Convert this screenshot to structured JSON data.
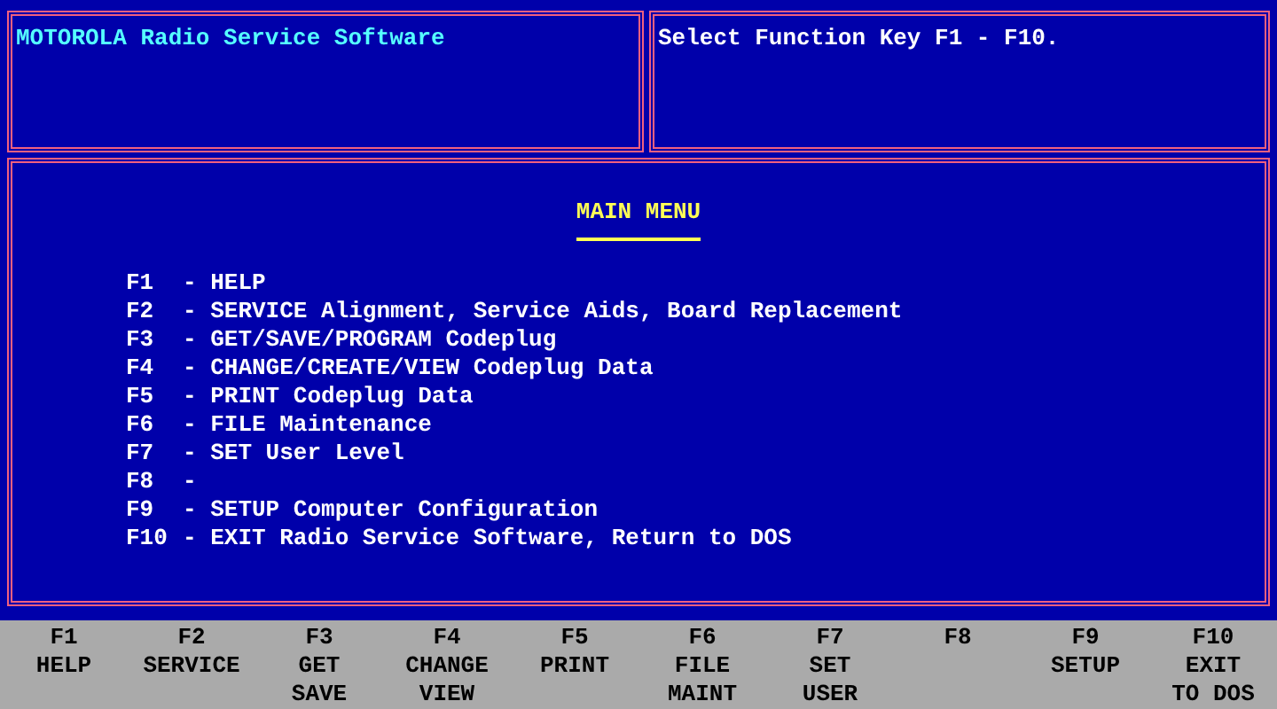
{
  "header": {
    "title": "MOTOROLA Radio Service Software",
    "prompt": "Select Function Key F1 - F10."
  },
  "main_menu": {
    "title": "MAIN MENU",
    "items": [
      {
        "key": "F1",
        "label": "- HELP"
      },
      {
        "key": "F2",
        "label": "- SERVICE Alignment, Service Aids, Board Replacement"
      },
      {
        "key": "F3",
        "label": "- GET/SAVE/PROGRAM Codeplug"
      },
      {
        "key": "F4",
        "label": "- CHANGE/CREATE/VIEW Codeplug Data"
      },
      {
        "key": "F5",
        "label": "- PRINT Codeplug Data"
      },
      {
        "key": "F6",
        "label": "- FILE Maintenance"
      },
      {
        "key": "F7",
        "label": "- SET User Level"
      },
      {
        "key": "F8",
        "label": "-"
      },
      {
        "key": "F9",
        "label": "- SETUP Computer Configuration"
      },
      {
        "key": "F10",
        "label": "- EXIT Radio Service Software, Return to DOS"
      }
    ]
  },
  "function_keys": [
    {
      "key": "F1",
      "lines": [
        "HELP"
      ]
    },
    {
      "key": "F2",
      "lines": [
        "SERVICE"
      ]
    },
    {
      "key": "F3",
      "lines": [
        "GET",
        "SAVE"
      ]
    },
    {
      "key": "F4",
      "lines": [
        "CHANGE",
        "VIEW"
      ]
    },
    {
      "key": "F5",
      "lines": [
        "PRINT"
      ]
    },
    {
      "key": "F6",
      "lines": [
        "FILE",
        "MAINT"
      ]
    },
    {
      "key": "F7",
      "lines": [
        "SET",
        "USER"
      ]
    },
    {
      "key": "F8"
    },
    {
      "key": "F9",
      "lines": [
        "SETUP"
      ]
    },
    {
      "key": "F10",
      "lines": [
        "EXIT",
        "TO DOS"
      ]
    }
  ]
}
